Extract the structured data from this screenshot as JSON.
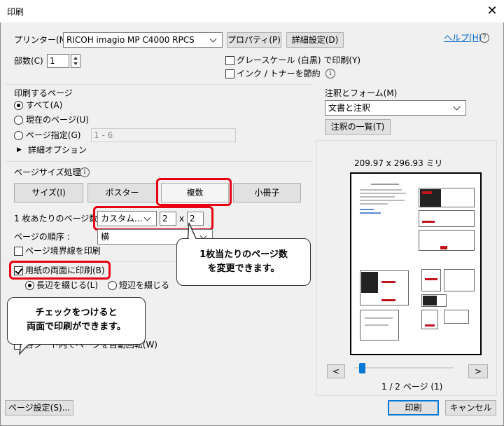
{
  "window": {
    "title": "印刷"
  },
  "printer": {
    "label": "プリンター(N) :",
    "selected": "RICOH imagio MP C4000 RPCS",
    "properties_label": "プロパティ(P)",
    "advanced_label": "詳細設定(D)",
    "help_label": "ヘルプ(H)"
  },
  "copies": {
    "label": "部数(C) :",
    "value": "1"
  },
  "options": {
    "grayscale_label": "グレースケール (白黒) で印刷(Y)",
    "ink_save_label": "インク / トナーを節約"
  },
  "pages_to_print": {
    "heading": "印刷するページ",
    "all_label": "すべて(A)",
    "current_label": "現在のページ(U)",
    "range_label": "ページ指定(G)",
    "range_value": "1 - 6",
    "more_options_label": "詳細オプション"
  },
  "page_sizing": {
    "heading": "ページサイズ処理",
    "tabs": [
      "サイズ(I)",
      "ポスター",
      "複数",
      "小冊子"
    ],
    "pages_per_sheet_label": "1 枚あたりのページ数",
    "pages_per_sheet_value": "カスタム...",
    "cols": "2",
    "rows": "2",
    "x_sep": "x",
    "order_label": "ページの順序 :",
    "order_value": "横",
    "border_label": "ページ境界線を印刷",
    "duplex_label": "用紙の両面に印刷(B)",
    "long_edge_label": "長辺を綴じる(L)",
    "short_edge_label": "短辺を綴じる",
    "auto_rotate_label": "各シート内でページを自動回転(W)"
  },
  "comments_forms": {
    "heading": "注釈とフォーム(M)",
    "selected": "文書と注釈",
    "summary_label": "注釈の一覧(T)"
  },
  "preview": {
    "dimensions": "209.97 x 296.93 ミリ",
    "prev_label": "<",
    "next_label": ">",
    "page_indicator": "1 / 2 ページ (1)",
    "slider_value": 0
  },
  "footer": {
    "page_setup_label": "ページ設定(S)...",
    "print_label": "印刷",
    "cancel_label": "キャンセル"
  },
  "callouts": {
    "pages_per_sheet": [
      "1枚当たりのページ数",
      "を変更できます。"
    ],
    "duplex": [
      "チェックをつけると",
      "両面で印刷ができます。"
    ]
  },
  "colors": {
    "highlight": "#e60012",
    "accent": "#0078d7"
  }
}
